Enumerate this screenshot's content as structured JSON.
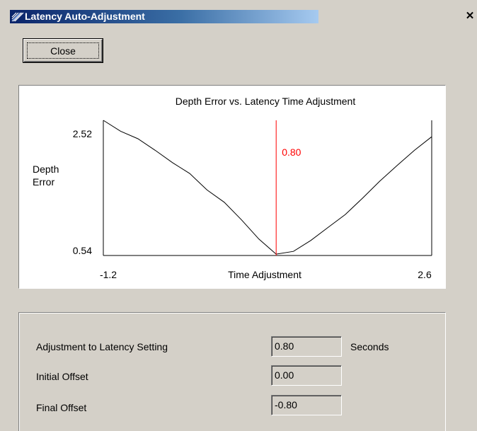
{
  "window": {
    "title": "Latency Auto-Adjustment",
    "close_glyph": "✕"
  },
  "toolbar": {
    "close_label": "Close"
  },
  "chart_data": {
    "type": "line",
    "title": "Depth Error vs. Latency Time Adjustment",
    "xlabel": "Time Adjustment",
    "ylabel": "Depth\nError",
    "ylabel_line1": "Depth",
    "ylabel_line2": "Error",
    "xlim": [
      -1.2,
      2.6
    ],
    "ylim": [
      0.54,
      2.52
    ],
    "xmin_label": "-1.2",
    "xmax_label": "2.6",
    "ymin_label": "0.54",
    "ymax_label": "2.52",
    "marker": {
      "x": 0.8,
      "label": "0.80",
      "color": "#ff0000"
    },
    "series": [
      {
        "color": "#000000",
        "x": [
          -1.2,
          -1.0,
          -0.8,
          -0.6,
          -0.4,
          -0.2,
          0.0,
          0.2,
          0.4,
          0.6,
          0.8,
          1.0,
          1.2,
          1.4,
          1.6,
          1.8,
          2.0,
          2.2,
          2.4,
          2.6
        ],
        "y": [
          2.52,
          2.36,
          2.25,
          2.08,
          1.9,
          1.74,
          1.5,
          1.32,
          1.06,
          0.78,
          0.56,
          0.6,
          0.76,
          0.95,
          1.14,
          1.38,
          1.63,
          1.86,
          2.08,
          2.28
        ]
      }
    ],
    "grid": false,
    "legend": "none"
  },
  "results": {
    "adjustment_label": "Adjustment to Latency Setting",
    "adjustment_value": "0.80",
    "adjustment_units": "Seconds",
    "initial_label": "Initial Offset",
    "initial_value": "0.00",
    "final_label": "Final Offset",
    "final_value": "-0.80"
  }
}
